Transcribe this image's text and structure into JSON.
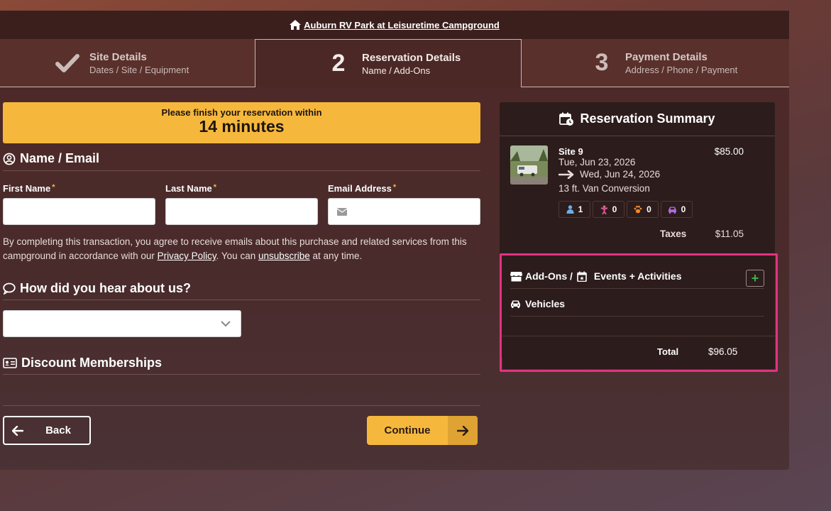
{
  "header": {
    "park_name": "Auburn RV Park at Leisuretime Campground"
  },
  "steps": [
    {
      "number": "",
      "title": "Site Details",
      "subtitle": "Dates / Site / Equipment",
      "state": "complete"
    },
    {
      "number": "2",
      "title": "Reservation Details",
      "subtitle": "Name / Add-Ons",
      "state": "active"
    },
    {
      "number": "3",
      "title": "Payment Details",
      "subtitle": "Address / Phone / Payment",
      "state": "upcoming"
    }
  ],
  "timer": {
    "line1": "Please finish your reservation within",
    "line2": "14 minutes"
  },
  "name_email": {
    "title": "Name / Email",
    "first_name_label": "First Name",
    "last_name_label": "Last Name",
    "email_label": "Email Address",
    "required_mark": "*",
    "first_name_value": "",
    "last_name_value": "",
    "email_value": ""
  },
  "consent": {
    "text_before": "By completing this transaction, you agree to receive emails about this purchase and related services from this campground in accordance with our ",
    "privacy_link": "Privacy Policy",
    "text_middle": ". You can ",
    "unsubscribe_link": "unsubscribe",
    "text_after": " at any time."
  },
  "hear_about": {
    "title": "How did you hear about us?",
    "selected": ""
  },
  "discount": {
    "title": "Discount Memberships"
  },
  "buttons": {
    "back": "Back",
    "continue": "Continue"
  },
  "summary": {
    "title": "Reservation Summary",
    "site_name": "Site 9",
    "site_price": "$85.00",
    "arrival": "Tue, Jun 23, 2026",
    "departure": "Wed, Jun 24, 2026",
    "equipment": "13 ft. Van Conversion",
    "guests": {
      "adults": "1",
      "children": "0",
      "pets": "0",
      "vehicles": "0"
    },
    "taxes_label": "Taxes",
    "taxes_value": "$11.05",
    "addons_label": "Add-Ons /",
    "events_label": "Events + Activities",
    "add_button": "+",
    "vehicles_label": "Vehicles",
    "total_label": "Total",
    "total_value": "$96.05"
  },
  "colors": {
    "accent": "#f5b83d",
    "highlight": "#e2337f",
    "plus": "#3bb44a"
  }
}
